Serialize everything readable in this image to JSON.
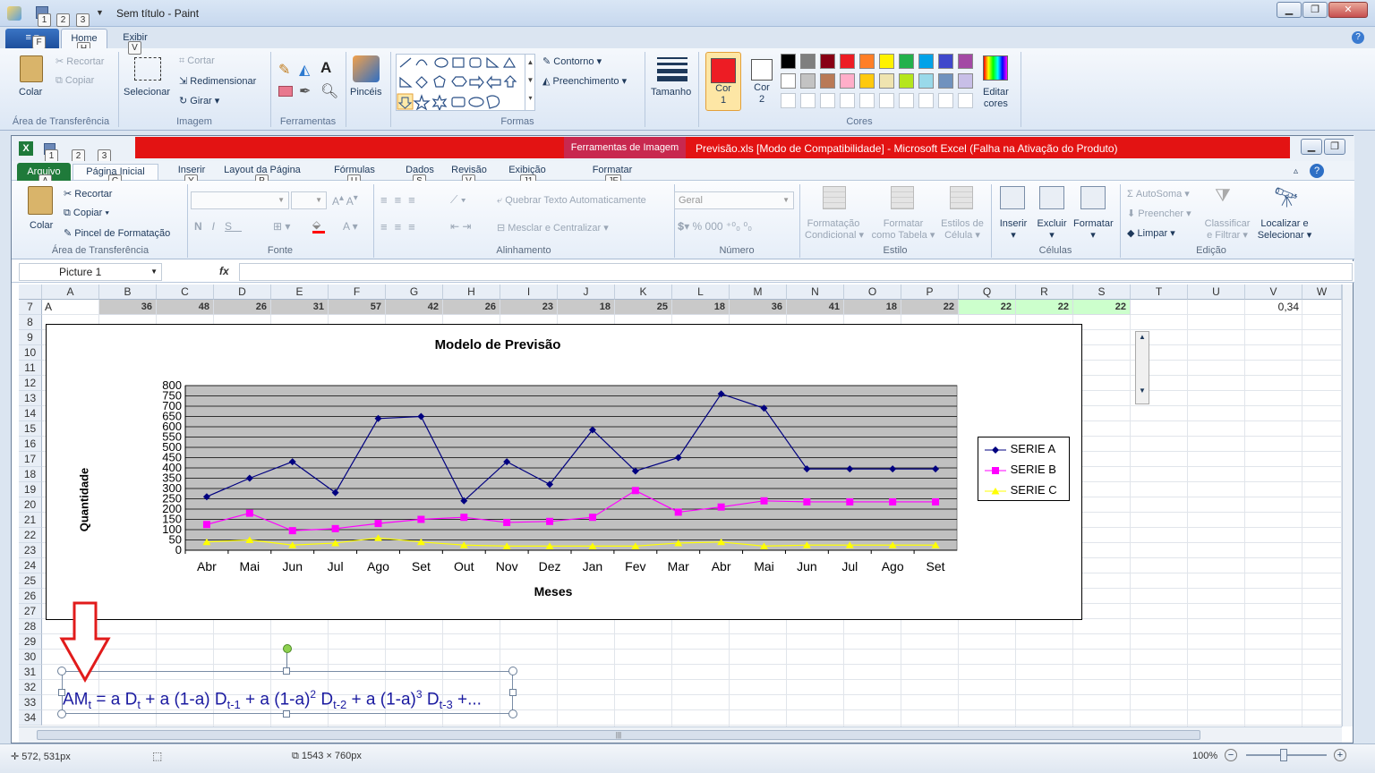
{
  "paint": {
    "title": "Sem título - Paint",
    "qat_keytips": [
      "1",
      "2",
      "3"
    ],
    "file_keytip": "F",
    "tabs": [
      {
        "label": "Home",
        "keytip": "H"
      },
      {
        "label": "Exibir",
        "keytip": "V"
      }
    ],
    "clipboard": {
      "paste": "Colar",
      "cut": "Recortar",
      "copy": "Copiar",
      "group": "Área de Transferência"
    },
    "image": {
      "select": "Selecionar",
      "crop": "Cortar",
      "resize": "Redimensionar",
      "rotate": "Girar",
      "group": "Imagem"
    },
    "tools": {
      "group": "Ferramentas"
    },
    "brushes": {
      "label": "Pincéis"
    },
    "shapes": {
      "outline": "Contorno",
      "fill": "Preenchimento",
      "group": "Formas"
    },
    "size": {
      "label": "Tamanho"
    },
    "color1": {
      "label1": "Cor",
      "label2": "1",
      "value": "#ed1c24"
    },
    "color2": {
      "label1": "Cor",
      "label2": "2",
      "value": "#ffffff"
    },
    "colors_group": "Cores",
    "edit_colors": {
      "label1": "Editar",
      "label2": "cores"
    },
    "palette_row1": [
      "#000000",
      "#7f7f7f",
      "#880015",
      "#ed1c24",
      "#ff7f27",
      "#fff200",
      "#22b14c",
      "#00a2e8",
      "#3f48cc",
      "#a349a4"
    ],
    "palette_row2": [
      "#ffffff",
      "#c3c3c3",
      "#b97a57",
      "#ffaec9",
      "#ffc90e",
      "#efe4b0",
      "#b5e61d",
      "#99d9ea",
      "#7092be",
      "#c8bfe7"
    ],
    "status": {
      "cursor": "572, 531px",
      "size": "1543 × 760px",
      "zoom": "100%"
    }
  },
  "excel": {
    "contextual_tab_header": "Ferramentas de Imagem",
    "title": "Previsão.xls  [Modo de Compatibilidade]  -  Microsoft Excel (Falha na Ativação do Produto)",
    "qat_keytips": [
      "1",
      "2",
      "3"
    ],
    "tabs": [
      {
        "label": "Arquivo",
        "keytip": "A"
      },
      {
        "label": "Página Inicial",
        "keytip": "C"
      },
      {
        "label": "Inserir",
        "keytip": "Y"
      },
      {
        "label": "Layout da Página",
        "keytip": "P"
      },
      {
        "label": "Fórmulas",
        "keytip": "U"
      },
      {
        "label": "Dados",
        "keytip": "S"
      },
      {
        "label": "Revisão",
        "keytip": "V"
      },
      {
        "label": "Exibição",
        "keytip": "J1"
      },
      {
        "label": "Formatar",
        "keytip": "JF"
      }
    ],
    "ribbon": {
      "paste": "Colar",
      "cut": "Recortar",
      "copy": "Copiar",
      "format_painter": "Pincel de Formatação",
      "clipboard_group": "Área de Transferência",
      "font_group": "Fonte",
      "wrap": "Quebrar Texto Automaticamente",
      "merge": "Mesclar e Centralizar",
      "align_group": "Alinhamento",
      "number_format": "Geral",
      "number_group": "Número",
      "cond_format": [
        "Formatação",
        "Condicional"
      ],
      "format_table": [
        "Formatar",
        "como Tabela"
      ],
      "cell_styles": [
        "Estilos de",
        "Célula"
      ],
      "styles_group": "Estilo",
      "insert": "Inserir",
      "delete": "Excluir",
      "format": "Formatar",
      "cells_group": "Células",
      "autosum": "AutoSoma",
      "fill": "Preencher",
      "clear": "Limpar",
      "sort": [
        "Classificar",
        "e Filtrar"
      ],
      "find": [
        "Localizar e",
        "Selecionar"
      ],
      "edit_group": "Edição"
    },
    "name_box": "Picture 1",
    "fx": "fx",
    "columns": [
      "A",
      "B",
      "C",
      "D",
      "E",
      "F",
      "G",
      "H",
      "I",
      "J",
      "K",
      "L",
      "M",
      "N",
      "O",
      "P",
      "Q",
      "R",
      "S",
      "T",
      "U",
      "V",
      "W"
    ],
    "rows": [
      "7",
      "8",
      "9",
      "10",
      "11",
      "12",
      "13",
      "14",
      "15",
      "16",
      "17",
      "18",
      "19",
      "20",
      "21",
      "22",
      "23",
      "24",
      "25",
      "26",
      "27",
      "28",
      "29",
      "30",
      "31",
      "32",
      "33",
      "34"
    ],
    "row7": {
      "label": "A",
      "values": [
        "36",
        "48",
        "26",
        "31",
        "57",
        "42",
        "26",
        "23",
        "18",
        "25",
        "18",
        "36",
        "41",
        "18",
        "22",
        "22",
        "22",
        "22"
      ],
      "v_cell": "0,34"
    }
  },
  "chart_data": {
    "type": "line",
    "title": "Modelo de Previsão",
    "xlabel": "Meses",
    "ylabel": "Quantidade",
    "categories": [
      "Abr",
      "Mai",
      "Jun",
      "Jul",
      "Ago",
      "Set",
      "Out",
      "Nov",
      "Dez",
      "Jan",
      "Fev",
      "Mar",
      "Abr",
      "Mai",
      "Jun",
      "Jul",
      "Ago",
      "Set"
    ],
    "ylim": [
      0,
      800
    ],
    "yticks": [
      "800",
      "750",
      "700",
      "650",
      "600",
      "550",
      "500",
      "450",
      "400",
      "350",
      "300",
      "250",
      "200",
      "150",
      "100",
      "50",
      "0"
    ],
    "grid": true,
    "legend": "right",
    "series": [
      {
        "name": "SERIE A",
        "color": "#000080",
        "marker": "diamond",
        "values": [
          260,
          350,
          430,
          280,
          640,
          650,
          240,
          430,
          320,
          585,
          385,
          450,
          760,
          690,
          395,
          395,
          395,
          395
        ]
      },
      {
        "name": "SERIE B",
        "color": "#ff00ff",
        "marker": "square",
        "values": [
          125,
          180,
          95,
          105,
          130,
          150,
          160,
          135,
          140,
          160,
          290,
          185,
          210,
          240,
          235,
          235,
          235,
          235
        ]
      },
      {
        "name": "SERIE C",
        "color": "#ffff00",
        "marker": "triangle",
        "values": [
          40,
          50,
          25,
          35,
          60,
          40,
          25,
          20,
          20,
          20,
          20,
          35,
          40,
          20,
          25,
          25,
          25,
          25
        ]
      }
    ]
  },
  "formula_text": {
    "parts": [
      {
        "t": "AM"
      },
      {
        "sub": "t"
      },
      {
        "t": " = a D"
      },
      {
        "sub": "t"
      },
      {
        "t": " + a (1-a) D"
      },
      {
        "sub": "t-1"
      },
      {
        "t": " + a (1-a)"
      },
      {
        "sup": "2"
      },
      {
        "t": " D"
      },
      {
        "sub": "t-2"
      },
      {
        "t": " + a (1-a)"
      },
      {
        "sup": "3"
      },
      {
        "t": " D"
      },
      {
        "sub": "t-3"
      },
      {
        "t": " +..."
      }
    ]
  }
}
